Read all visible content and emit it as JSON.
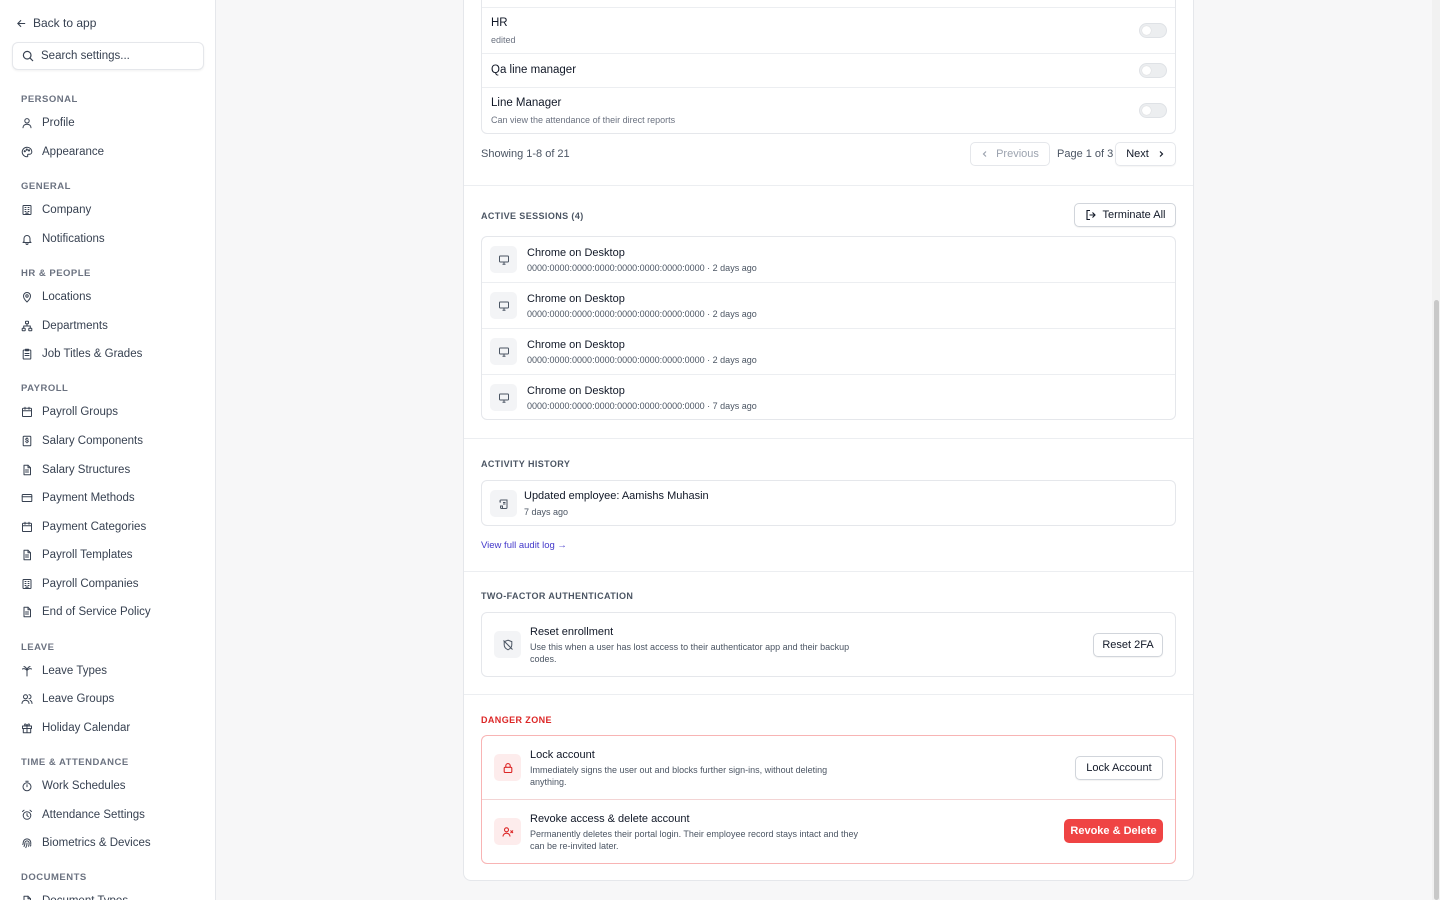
{
  "sidebar": {
    "back_label": "Back to app",
    "search_placeholder": "Search settings...",
    "sections": [
      {
        "title": "PERSONAL",
        "items": [
          {
            "label": "Profile",
            "icon": "user-icon"
          },
          {
            "label": "Appearance",
            "icon": "palette-icon"
          }
        ]
      },
      {
        "title": "GENERAL",
        "items": [
          {
            "label": "Company",
            "icon": "building-icon"
          },
          {
            "label": "Notifications",
            "icon": "bell-icon"
          }
        ]
      },
      {
        "title": "HR & PEOPLE",
        "items": [
          {
            "label": "Locations",
            "icon": "map-pin-icon"
          },
          {
            "label": "Departments",
            "icon": "org-chart-icon"
          },
          {
            "label": "Job Titles & Grades",
            "icon": "clipboard-icon"
          }
        ]
      },
      {
        "title": "PAYROLL",
        "items": [
          {
            "label": "Payroll Groups",
            "icon": "calendar-icon"
          },
          {
            "label": "Salary Components",
            "icon": "dollar-doc-icon"
          },
          {
            "label": "Salary Structures",
            "icon": "document-icon"
          },
          {
            "label": "Payment Methods",
            "icon": "credit-card-icon"
          },
          {
            "label": "Payment Categories",
            "icon": "calendar-icon"
          },
          {
            "label": "Payroll Templates",
            "icon": "document-icon"
          },
          {
            "label": "Payroll Companies",
            "icon": "building-icon"
          },
          {
            "label": "End of Service Policy",
            "icon": "document-icon"
          }
        ]
      },
      {
        "title": "LEAVE",
        "items": [
          {
            "label": "Leave Types",
            "icon": "palm-tree-icon"
          },
          {
            "label": "Leave Groups",
            "icon": "users-icon"
          },
          {
            "label": "Holiday Calendar",
            "icon": "gift-icon"
          }
        ]
      },
      {
        "title": "TIME & ATTENDANCE",
        "items": [
          {
            "label": "Work Schedules",
            "icon": "timer-icon"
          },
          {
            "label": "Attendance Settings",
            "icon": "alarm-clock-icon"
          },
          {
            "label": "Biometrics & Devices",
            "icon": "fingerprint-icon"
          }
        ]
      },
      {
        "title": "DOCUMENTS",
        "items": [
          {
            "label": "Document Types",
            "icon": "document-icon"
          }
        ]
      }
    ]
  },
  "roles": {
    "rows": [
      {
        "name": "HR",
        "description": "edited",
        "enabled": false
      },
      {
        "name": "Qa line manager",
        "description": "",
        "enabled": false
      },
      {
        "name": "Line Manager",
        "description": "Can view the attendance of their direct reports",
        "enabled": false
      }
    ],
    "showing": "Showing 1-8 of 21",
    "previous_label": "Previous",
    "page_label": "Page 1 of 3",
    "next_label": "Next"
  },
  "sessions": {
    "title": "ACTIVE SESSIONS (4)",
    "terminate_label": "Terminate All",
    "items": [
      {
        "device": "Chrome on Desktop",
        "detail": "0000:0000:0000:0000:0000:0000:0000:0000 · 2 days ago"
      },
      {
        "device": "Chrome on Desktop",
        "detail": "0000:0000:0000:0000:0000:0000:0000:0000 · 2 days ago"
      },
      {
        "device": "Chrome on Desktop",
        "detail": "0000:0000:0000:0000:0000:0000:0000:0000 · 2 days ago"
      },
      {
        "device": "Chrome on Desktop",
        "detail": "0000:0000:0000:0000:0000:0000:0000:0000 · 7 days ago"
      }
    ]
  },
  "activity": {
    "title": "ACTIVITY HISTORY",
    "items": [
      {
        "text": "Updated employee: Aamishs Muhasin",
        "time": "7 days ago"
      }
    ],
    "audit_link": "View full audit log →"
  },
  "two_factor": {
    "title": "TWO-FACTOR AUTHENTICATION",
    "reset_title": "Reset enrollment",
    "reset_desc": "Use this when a user has lost access to their authenticator app and their backup codes.",
    "reset_button": "Reset 2FA"
  },
  "danger": {
    "title": "DANGER ZONE",
    "lock_title": "Lock account",
    "lock_desc": "Immediately signs the user out and blocks further sign-ins, without deleting anything.",
    "lock_button": "Lock Account",
    "revoke_title": "Revoke access & delete account",
    "revoke_desc": "Permanently deletes their portal login. Their employee record stays intact and they can be re-invited later.",
    "revoke_button": "Revoke & Delete"
  },
  "colors": {
    "danger": "#ef4444",
    "link": "#4338ca",
    "danger_border": "#f8b4b4"
  }
}
